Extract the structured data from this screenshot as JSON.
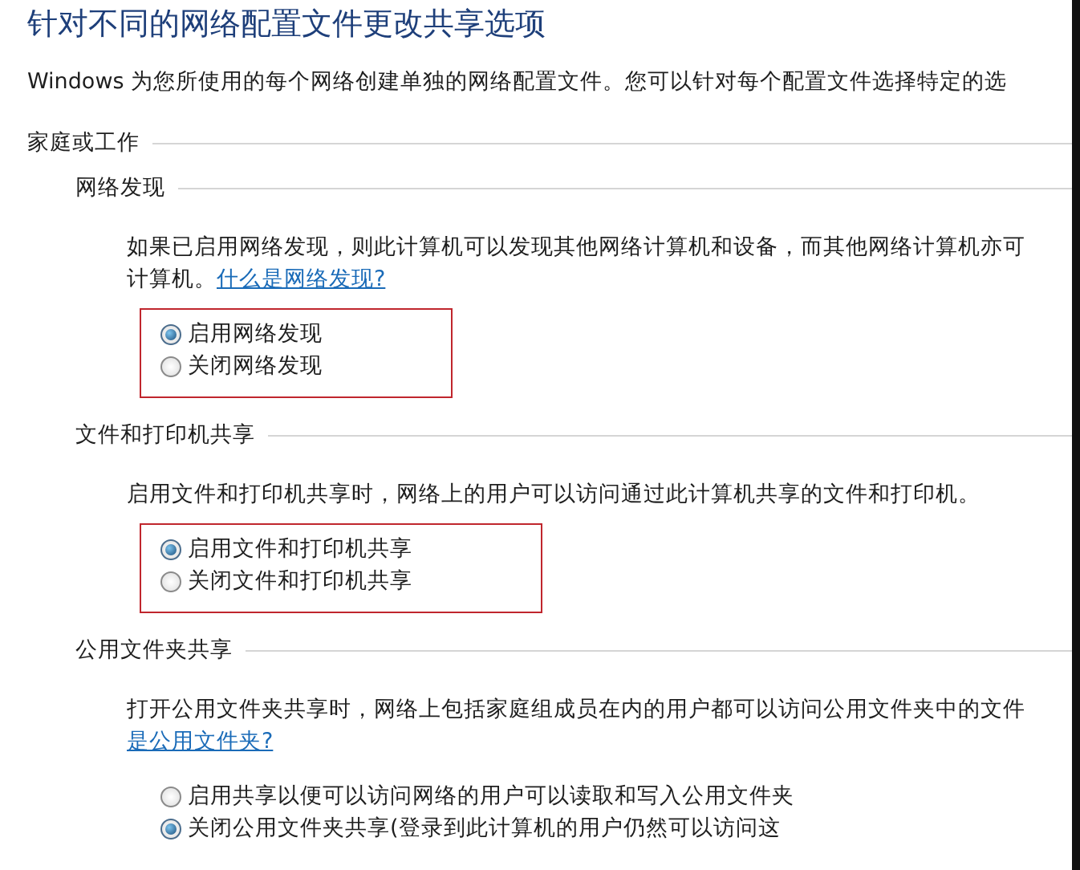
{
  "title": "针对不同的网络配置文件更改共享选项",
  "description": "Windows 为您所使用的每个网络创建单独的网络配置文件。您可以针对每个配置文件选择特定的选",
  "profile": {
    "heading": "家庭或工作",
    "sections": [
      {
        "heading": "网络发现",
        "lines": [
          "如果已启用网络发现，则此计算机可以发现其他网络计算机和设备，而其他网络计算机亦可",
          "计算机。"
        ],
        "link": "什么是网络发现?",
        "highlighted": true,
        "options": [
          {
            "label": "启用网络发现",
            "selected": true
          },
          {
            "label": "关闭网络发现",
            "selected": false
          }
        ]
      },
      {
        "heading": "文件和打印机共享",
        "lines": [
          "启用文件和打印机共享时，网络上的用户可以访问通过此计算机共享的文件和打印机。"
        ],
        "highlighted": true,
        "options": [
          {
            "label": "启用文件和打印机共享",
            "selected": true
          },
          {
            "label": "关闭文件和打印机共享",
            "selected": false
          }
        ]
      },
      {
        "heading": "公用文件夹共享",
        "lines": [
          "打开公用文件夹共享时，网络上包括家庭组成员在内的用户都可以访问公用文件夹中的文件"
        ],
        "link": "是公用文件夹?",
        "highlighted": false,
        "options": [
          {
            "label": "启用共享以便可以访问网络的用户可以读取和写入公用文件夹",
            "selected": false
          },
          {
            "label": "关闭公用文件夹共享(登录到此计算机的用户仍然可以访问这",
            "selected": true
          }
        ]
      }
    ]
  }
}
